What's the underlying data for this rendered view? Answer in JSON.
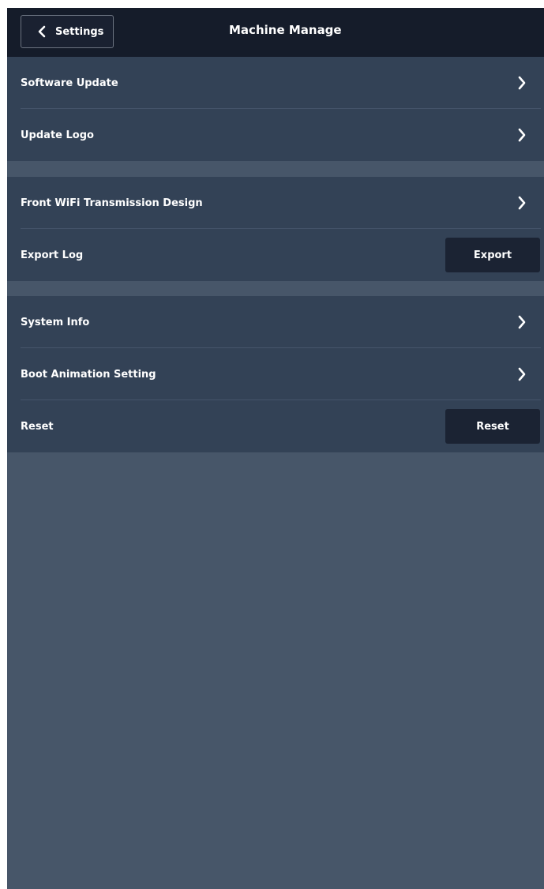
{
  "header": {
    "back_label": "Settings",
    "back_icon": "chevron-left-icon",
    "title": "Machine Manage"
  },
  "groups": [
    {
      "rows": [
        {
          "label": "Software Update",
          "control": "chevron-right-icon"
        },
        {
          "label": "Update Logo",
          "control": "chevron-right-icon"
        }
      ]
    },
    {
      "rows": [
        {
          "label": "Front WiFi Transmission Design",
          "control": "chevron-right-icon"
        },
        {
          "label": "Export Log",
          "action_label": "Export"
        }
      ]
    },
    {
      "rows": [
        {
          "label": "System Info",
          "control": "chevron-right-icon"
        },
        {
          "label": "Boot Animation Setting",
          "control": "chevron-right-icon"
        },
        {
          "label": "Reset",
          "action_label": "Reset"
        }
      ]
    }
  ],
  "colors": {
    "header_bg": "#151c2a",
    "row_bg": "#334256",
    "page_bg": "#475669",
    "button_bg": "#1b2333",
    "text": "#ffffff"
  }
}
